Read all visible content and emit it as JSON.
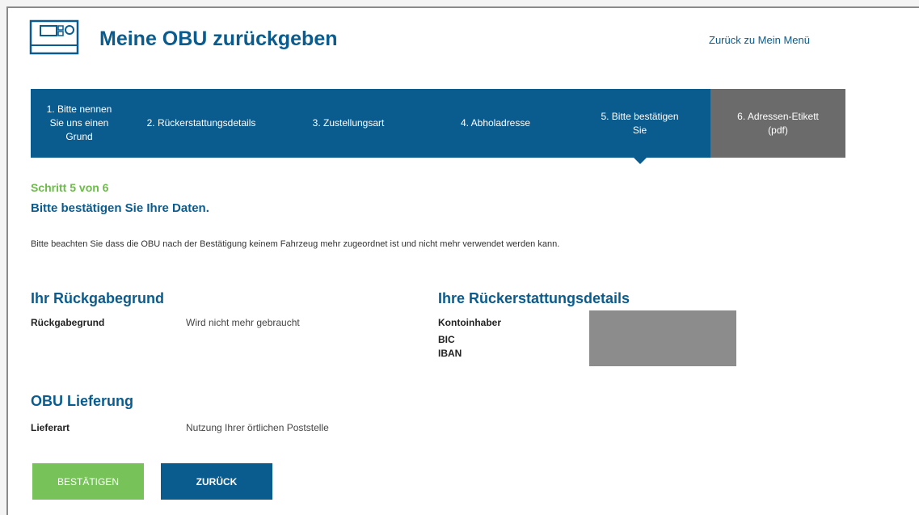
{
  "header": {
    "title": "Meine OBU zurückgeben",
    "menu_link": "Zurück zu Mein Menü",
    "icon": "obu-device-icon"
  },
  "steps": [
    {
      "line1": "1. Bitte nennen",
      "line2": "Sie uns einen",
      "line3": "Grund",
      "state": "done"
    },
    {
      "line1": "2. Rückerstattungsdetails",
      "state": "done"
    },
    {
      "line1": "3. Zustellungsart",
      "state": "done"
    },
    {
      "line1": "4. Abholadresse",
      "state": "done"
    },
    {
      "line1": "5. Bitte bestätigen",
      "line2": "Sie",
      "state": "active"
    },
    {
      "line1": "6. Adressen-Etikett",
      "line2": "(pdf)",
      "state": "upcoming"
    }
  ],
  "progress": {
    "counter": "Schritt 5 von 6",
    "heading": "Bitte bestätigen Sie Ihre Daten."
  },
  "notice": "Bitte beachten Sie dass die OBU nach der Bestätigung keinem Fahrzeug mehr zugeordnet ist und nicht mehr verwendet werden kann.",
  "return_reason": {
    "heading": "Ihr Rückgabegrund",
    "label": "Rückgabegrund",
    "value": "Wird nicht mehr gebraucht"
  },
  "refund": {
    "heading": "Ihre Rückerstattungsdetails",
    "labels": [
      "Kontoinhaber",
      "BIC",
      "IBAN"
    ]
  },
  "delivery": {
    "heading": "OBU Lieferung",
    "label": "Lieferart",
    "value": "Nutzung Ihrer örtlichen Poststelle"
  },
  "buttons": {
    "confirm": "BESTÄTIGEN",
    "back": "ZURÜCK"
  },
  "colors": {
    "primary": "#0a5c8f",
    "accent_green": "#6dbb4b",
    "confirm_button": "#77c35a",
    "inactive_step": "#6b6b6b"
  }
}
